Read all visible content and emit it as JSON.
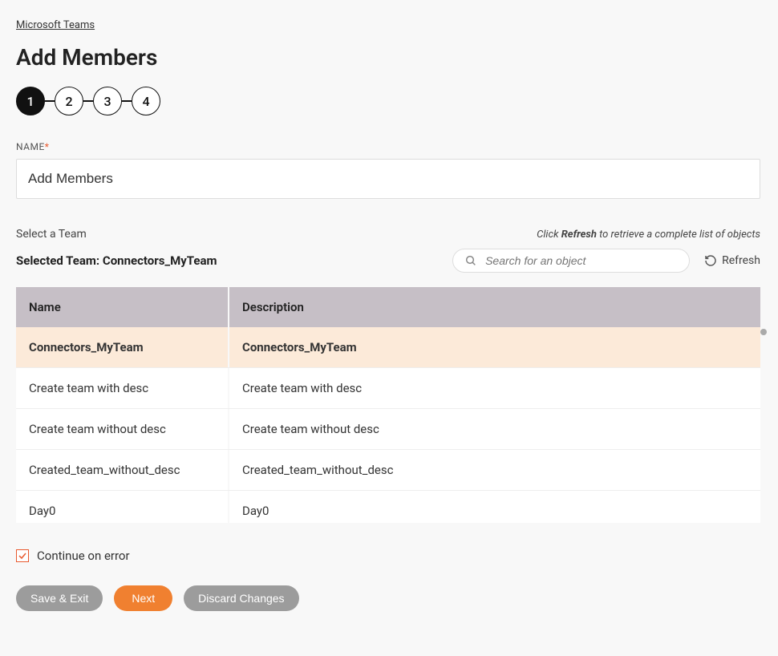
{
  "breadcrumb": "Microsoft Teams",
  "page_title": "Add Members",
  "stepper": {
    "steps": [
      "1",
      "2",
      "3",
      "4"
    ],
    "active_index": 0
  },
  "name_field": {
    "label": "NAME",
    "value": "Add Members"
  },
  "select_team": {
    "label": "Select a Team",
    "hint_prefix": "Click ",
    "hint_bold": "Refresh",
    "hint_suffix": " to retrieve a complete list of objects",
    "selected_prefix": "Selected Team: ",
    "selected_name": "Connectors_MyTeam"
  },
  "search": {
    "placeholder": "Search for an object"
  },
  "refresh": {
    "label": "Refresh"
  },
  "table": {
    "columns": {
      "name": "Name",
      "desc": "Description"
    },
    "rows": [
      {
        "name": "Connectors_MyTeam",
        "desc": "Connectors_MyTeam",
        "selected": true
      },
      {
        "name": "Create team with desc",
        "desc": "Create team with desc",
        "selected": false
      },
      {
        "name": "Create team without desc",
        "desc": "Create team without desc",
        "selected": false
      },
      {
        "name": "Created_team_without_desc",
        "desc": "Created_team_without_desc",
        "selected": false
      },
      {
        "name": "Day0",
        "desc": "Day0",
        "selected": false
      }
    ]
  },
  "continue_on_error": {
    "label": "Continue on error",
    "checked": true
  },
  "buttons": {
    "save_exit": "Save & Exit",
    "next": "Next",
    "discard": "Discard Changes"
  }
}
